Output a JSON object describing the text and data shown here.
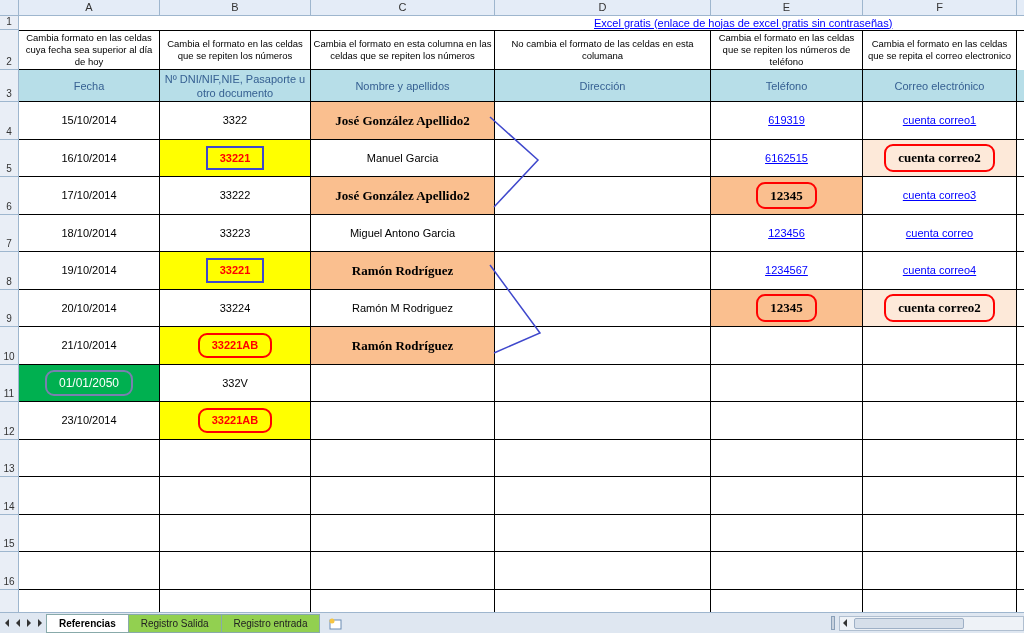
{
  "column_headers": [
    "A",
    "B",
    "C",
    "D",
    "E",
    "F"
  ],
  "row_numbers": [
    "1",
    "2",
    "3",
    "4",
    "5",
    "6",
    "7",
    "8",
    "9",
    "10",
    "11",
    "12",
    "13",
    "14",
    "15",
    "16"
  ],
  "link": "Excel gratis (enlace de hojas de excel  gratis sin contraseñas)",
  "notes": [
    "Cambia formato  en las celdas cuya fecha sea superior al día de hoy",
    "Cambia el formato en las celdas que se repiten los números",
    "Cambia el formato en esta columna en las celdas que se repiten los números",
    "No cambia el formato de las celdas en esta columana",
    "Cambia el formato en las celdas que se repiten los números de teléfono",
    "Cambia el formato en las celdas que se repita el correo electronico"
  ],
  "headers": [
    "Fecha",
    "Nº DNI/NIF,NIE, Pasaporte  u otro documento",
    "Nombre y apellidos",
    "Dirección",
    "Teléfono",
    "Correo electrónico"
  ],
  "rows": [
    {
      "cells": [
        {
          "text": "15/10/2014",
          "kind": "plain"
        },
        {
          "text": "3322",
          "kind": "plain"
        },
        {
          "text": "José González Apellido2",
          "kind": "dup_name"
        },
        {
          "kind": "empty"
        },
        {
          "text": "619319",
          "kind": "link"
        },
        {
          "text": "cuenta correo1",
          "kind": "link"
        }
      ]
    },
    {
      "cells": [
        {
          "text": "16/10/2014",
          "kind": "plain"
        },
        {
          "text": "33221",
          "kind": "dup_number",
          "boxed": true,
          "color": "#3f48cc"
        },
        {
          "text": "Manuel Garcia",
          "kind": "plain"
        },
        {
          "kind": "empty"
        },
        {
          "text": "6162515",
          "kind": "link"
        },
        {
          "text": "cuenta correo2",
          "kind": "dup_mail",
          "circled": true,
          "color": "#ff0000"
        }
      ]
    },
    {
      "cells": [
        {
          "text": "17/10/2014",
          "kind": "plain"
        },
        {
          "text": "33222",
          "kind": "plain"
        },
        {
          "text": "José González Apellido2",
          "kind": "dup_name"
        },
        {
          "kind": "empty"
        },
        {
          "text": "12345",
          "kind": "dup_name",
          "circled": true,
          "color": "#ff0000"
        },
        {
          "text": "cuenta correo3",
          "kind": "link"
        }
      ]
    },
    {
      "cells": [
        {
          "text": "18/10/2014",
          "kind": "plain"
        },
        {
          "text": "33223",
          "kind": "plain"
        },
        {
          "text": "Miguel Antono Garcia",
          "kind": "plain"
        },
        {
          "kind": "empty"
        },
        {
          "text": "123456",
          "kind": "link"
        },
        {
          "text": "cuenta correo",
          "kind": "link"
        }
      ]
    },
    {
      "cells": [
        {
          "text": "19/10/2014",
          "kind": "plain"
        },
        {
          "text": "33221",
          "kind": "dup_number",
          "boxed": true,
          "color": "#3f48cc"
        },
        {
          "text": "Ramón Rodríguez",
          "kind": "dup_name"
        },
        {
          "kind": "empty"
        },
        {
          "text": "1234567",
          "kind": "link"
        },
        {
          "text": "cuenta correo4",
          "kind": "link"
        }
      ]
    },
    {
      "cells": [
        {
          "text": "20/10/2014",
          "kind": "plain"
        },
        {
          "text": "33224",
          "kind": "plain"
        },
        {
          "text": "Ramón M Rodriguez",
          "kind": "plain"
        },
        {
          "kind": "empty"
        },
        {
          "text": "12345",
          "kind": "dup_name",
          "circled": true,
          "color": "#ff0000"
        },
        {
          "text": "cuenta correo2",
          "kind": "dup_mail",
          "circled": true,
          "color": "#ff0000"
        }
      ]
    },
    {
      "cells": [
        {
          "text": "21/10/2014",
          "kind": "plain"
        },
        {
          "text": "33221AB",
          "kind": "dup_number",
          "circled": true,
          "color": "#ff0000"
        },
        {
          "text": "Ramón Rodríguez",
          "kind": "dup_name"
        },
        {
          "kind": "empty"
        },
        {
          "kind": "empty"
        },
        {
          "kind": "empty"
        }
      ]
    },
    {
      "cells": [
        {
          "text": "01/01/2050",
          "kind": "future_date",
          "circled": true,
          "color": "#7a7fb0"
        },
        {
          "text": "332V",
          "kind": "plain"
        },
        {
          "kind": "empty"
        },
        {
          "kind": "empty"
        },
        {
          "kind": "empty"
        },
        {
          "kind": "empty"
        }
      ]
    },
    {
      "cells": [
        {
          "text": "23/10/2014",
          "kind": "plain"
        },
        {
          "text": "33221AB",
          "kind": "dup_number",
          "circled": true,
          "color": "#ff0000"
        },
        {
          "kind": "empty"
        },
        {
          "kind": "empty"
        },
        {
          "kind": "empty"
        },
        {
          "kind": "empty"
        }
      ]
    }
  ],
  "sheet_tabs": [
    {
      "label": "Referencias",
      "selected": true
    },
    {
      "label": "Registro Salida",
      "selected": false
    },
    {
      "label": "Registro entrada",
      "selected": false
    }
  ]
}
